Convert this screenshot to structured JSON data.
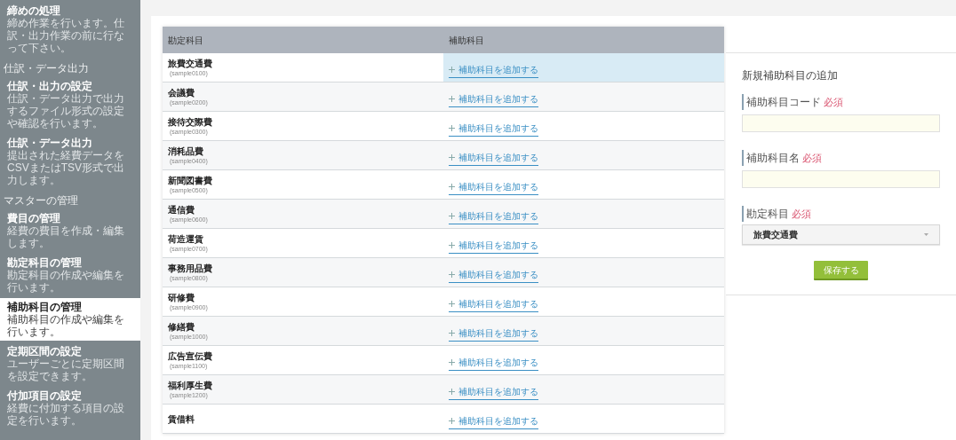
{
  "sidebar": {
    "groups": [
      {
        "items": [
          {
            "title": "締めの処理",
            "description": "締め作業を行います。仕訳・出力作業の前に行なって下さい。",
            "selected": false
          }
        ]
      },
      {
        "heading": "仕訳・データ出力",
        "items": [
          {
            "title": "仕訳・出力の設定",
            "description": "仕訳・データ出力で出力するファイル形式の設定や確認を行います。",
            "selected": false
          },
          {
            "title": "仕訳・データ出力",
            "description": "提出された経費データをCSVまたはTSV形式で出力します。",
            "selected": false
          }
        ]
      },
      {
        "heading": "マスターの管理",
        "items": [
          {
            "title": "費目の管理",
            "description": "経費の費目を作成・編集します。",
            "selected": false
          },
          {
            "title": "勘定科目の管理",
            "description": "勘定科目の作成や編集を行います。",
            "selected": false
          },
          {
            "title": "補助科目の管理",
            "description": "補助科目の作成や編集を行います。",
            "selected": true
          },
          {
            "title": "定期区間の設定",
            "description": "ユーザーごとに定期区間を設定できます。",
            "selected": false
          },
          {
            "title": "付加項目の設定",
            "description": "経費に付加する項目の設定を行います。",
            "selected": false
          }
        ]
      }
    ]
  },
  "table": {
    "columns": [
      "勘定科目",
      "補助科目"
    ],
    "rows": [
      {
        "name": "旅費交通費",
        "code": "(sample0100)",
        "add_link": "補助科目を追加する",
        "selected": true
      },
      {
        "name": "会議費",
        "code": "(sample0200)",
        "add_link": "補助科目を追加する",
        "selected": false
      },
      {
        "name": "接待交際費",
        "code": "(sample0300)",
        "add_link": "補助科目を追加する",
        "selected": false
      },
      {
        "name": "消耗品費",
        "code": "(sample0400)",
        "add_link": "補助科目を追加する",
        "selected": false
      },
      {
        "name": "新聞図書費",
        "code": "(sample0500)",
        "add_link": "補助科目を追加する",
        "selected": false
      },
      {
        "name": "通信費",
        "code": "(sample0600)",
        "add_link": "補助科目を追加する",
        "selected": false
      },
      {
        "name": "荷造運賃",
        "code": "(sample0700)",
        "add_link": "補助科目を追加する",
        "selected": false
      },
      {
        "name": "事務用品費",
        "code": "(sample0800)",
        "add_link": "補助科目を追加する",
        "selected": false
      },
      {
        "name": "研修費",
        "code": "(sample0900)",
        "add_link": "補助科目を追加する",
        "selected": false
      },
      {
        "name": "修繕費",
        "code": "(sample1000)",
        "add_link": "補助科目を追加する",
        "selected": false
      },
      {
        "name": "広告宣伝費",
        "code": "(sample1100)",
        "add_link": "補助科目を追加する",
        "selected": false
      },
      {
        "name": "福利厚生費",
        "code": "(sample1200)",
        "add_link": "補助科目を追加する",
        "selected": false
      },
      {
        "name": "賃借料",
        "add_link": "補助科目を追加する",
        "selected": false
      }
    ]
  },
  "form": {
    "title": "新規補助科目の追加",
    "fields": [
      {
        "kind": "text",
        "label": "補助科目コード",
        "required_mark": "必須"
      },
      {
        "kind": "text",
        "label": "補助科目名",
        "required_mark": "必須"
      },
      {
        "kind": "select",
        "label": "勘定科目",
        "required_mark": "必須",
        "value": "旅費交通費"
      }
    ],
    "submit": "保存する"
  }
}
